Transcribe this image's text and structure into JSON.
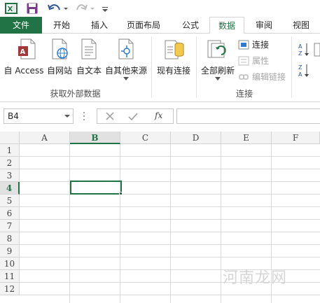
{
  "quick_access": {
    "app_icon": "excel-logo-icon",
    "save_icon": "save-icon",
    "undo_icon": "undo-icon",
    "redo_icon": "redo-icon",
    "customize_icon": "customize-qat-icon"
  },
  "tabs": [
    {
      "label": "文件"
    },
    {
      "label": "开始"
    },
    {
      "label": "插入"
    },
    {
      "label": "页面布局"
    },
    {
      "label": "公式"
    },
    {
      "label": "数据"
    },
    {
      "label": "审阅"
    },
    {
      "label": "视图"
    }
  ],
  "active_tab": "数据",
  "ribbon": {
    "get_external": {
      "buttons": [
        {
          "label": "自 Access",
          "icon": "access-database-icon"
        },
        {
          "label": "自网站",
          "icon": "web-page-icon"
        },
        {
          "label": "自文本",
          "icon": "text-file-icon"
        },
        {
          "label": "自其他来源",
          "icon": "other-sources-icon"
        }
      ],
      "group_label": "获取外部数据"
    },
    "existing": {
      "label": "现有连接",
      "icon": "existing-connections-icon"
    },
    "connections": {
      "refresh_all": {
        "label": "全部刷新",
        "icon": "refresh-all-icon"
      },
      "connections_label": "连接",
      "properties_label": "属性",
      "edit_links_label": "编辑链接",
      "group_label": "连接"
    }
  },
  "formula_bar": {
    "name_box": "B4",
    "cancel_icon": "cancel-icon",
    "enter_icon": "enter-icon",
    "fx_label": "fx",
    "value": ""
  },
  "grid": {
    "columns": [
      "A",
      "B",
      "C",
      "D",
      "E",
      "F"
    ],
    "rows": [
      "1",
      "2",
      "3",
      "4",
      "5",
      "6",
      "7",
      "8",
      "9",
      "10",
      "11",
      "12"
    ],
    "selected_column": "B",
    "selected_row": "4"
  },
  "watermark": "河南龙网",
  "colors": {
    "accent": "#217346",
    "gridline": "#dadada",
    "header_bg": "#f3f3f3"
  }
}
